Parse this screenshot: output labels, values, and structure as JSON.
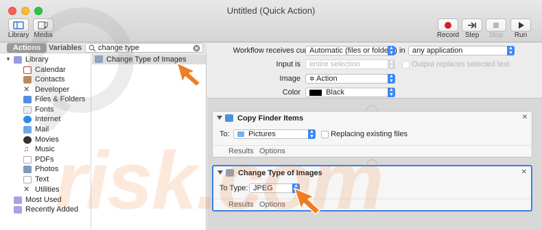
{
  "window": {
    "title": "Untitled (Quick Action)"
  },
  "toolbar": {
    "library_label": "Library",
    "media_label": "Media",
    "record_label": "Record",
    "step_label": "Step",
    "stop_label": "Stop",
    "run_label": "Run"
  },
  "left_pane": {
    "tab_actions": "Actions",
    "tab_variables": "Variables",
    "search_value": "change type",
    "tree": [
      {
        "label": "Library",
        "icon": "library-folder-icon"
      },
      {
        "label": "Calendar",
        "icon": "calendar-icon"
      },
      {
        "label": "Contacts",
        "icon": "contacts-icon"
      },
      {
        "label": "Developer",
        "icon": "developer-icon"
      },
      {
        "label": "Files & Folders",
        "icon": "files-folders-icon"
      },
      {
        "label": "Fonts",
        "icon": "fonts-icon"
      },
      {
        "label": "Internet",
        "icon": "internet-icon"
      },
      {
        "label": "Mail",
        "icon": "mail-icon"
      },
      {
        "label": "Movies",
        "icon": "movies-icon"
      },
      {
        "label": "Music",
        "icon": "music-icon"
      },
      {
        "label": "PDFs",
        "icon": "pdfs-icon"
      },
      {
        "label": "Photos",
        "icon": "photos-icon"
      },
      {
        "label": "Text",
        "icon": "text-icon"
      },
      {
        "label": "Utilities",
        "icon": "utilities-icon"
      },
      {
        "label": "Most Used",
        "icon": "smart-folder-icon"
      },
      {
        "label": "Recently Added",
        "icon": "smart-folder-icon"
      }
    ],
    "result": "Change Type of Images"
  },
  "workflow": {
    "receives_label": "Workflow receives current",
    "receives_value": "Automatic (files or folders)",
    "in_label": "in",
    "in_value": "any application",
    "input_is_label": "Input is",
    "input_is_value": "entire selection",
    "output_replaces_label": "Output replaces selected text",
    "image_label": "Image",
    "image_value": "Action",
    "color_label": "Color",
    "color_value": "Black",
    "color_swatch": "#000000"
  },
  "actions": [
    {
      "title": "Copy Finder Items",
      "field_label": "To:",
      "field_value": "Pictures",
      "checkbox_label": "Replacing existing files",
      "results_tab": "Results",
      "options_tab": "Options"
    },
    {
      "title": "Change Type of Images",
      "field_label": "To Type:",
      "field_value": "JPEG",
      "results_tab": "Results",
      "options_tab": "Options"
    }
  ],
  "watermark": {
    "text": "risk.com"
  },
  "colors": {
    "accent": "#3a7ee2",
    "arrow": "#f07c22",
    "record": "#d4202a"
  }
}
